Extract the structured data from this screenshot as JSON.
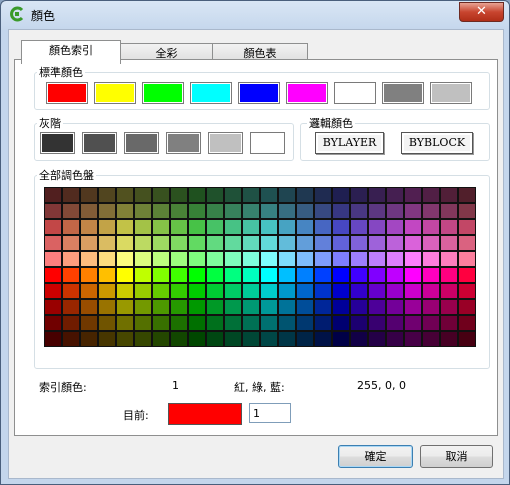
{
  "window": {
    "title": "顏色",
    "close_label": "✕"
  },
  "tabs": [
    {
      "label": "顏色索引",
      "active": true
    },
    {
      "label": "全彩",
      "active": false
    },
    {
      "label": "顏色表",
      "active": false
    }
  ],
  "standard_colors": {
    "label": "標準顏色",
    "colors": [
      "#ff0000",
      "#ffff00",
      "#00ff00",
      "#00ffff",
      "#0000ff",
      "#ff00ff",
      "#ffffff",
      "#808080",
      "#c0c0c0"
    ]
  },
  "gray": {
    "label": "灰階",
    "colors": [
      "#333333",
      "#505050",
      "#696969",
      "#808080",
      "#c0c0c0",
      "#ffffff"
    ]
  },
  "logical": {
    "label": "邏輯顏色",
    "bylayer": "BYLAYER",
    "byblock": "BYBLOCK"
  },
  "palette": {
    "label": "全部調色盤",
    "columns": 24,
    "rows": 10
  },
  "info": {
    "index_label": "索引顏色:",
    "index_value": "1",
    "rgb_label": "紅, 綠, 藍:",
    "rgb_value": "255, 0, 0"
  },
  "current": {
    "label": "目前:",
    "color": "#ff0000",
    "value": "1"
  },
  "buttons": {
    "ok": "確定",
    "cancel": "取消"
  }
}
